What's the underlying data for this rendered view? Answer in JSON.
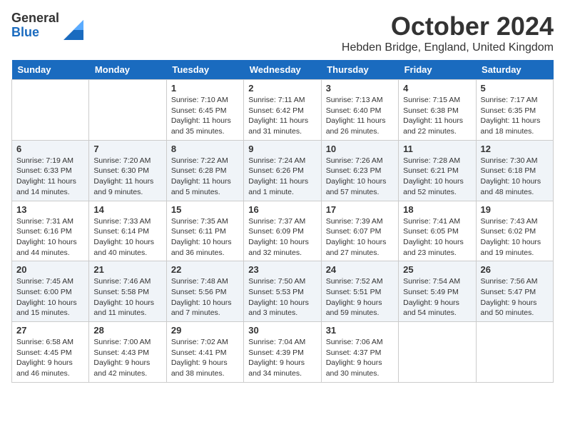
{
  "logo": {
    "general": "General",
    "blue": "Blue"
  },
  "title": "October 2024",
  "location": "Hebden Bridge, England, United Kingdom",
  "days_of_week": [
    "Sunday",
    "Monday",
    "Tuesday",
    "Wednesday",
    "Thursday",
    "Friday",
    "Saturday"
  ],
  "weeks": [
    [
      {
        "day": "",
        "sunrise": "",
        "sunset": "",
        "daylight": ""
      },
      {
        "day": "",
        "sunrise": "",
        "sunset": "",
        "daylight": ""
      },
      {
        "day": "1",
        "sunrise": "Sunrise: 7:10 AM",
        "sunset": "Sunset: 6:45 PM",
        "daylight": "Daylight: 11 hours and 35 minutes."
      },
      {
        "day": "2",
        "sunrise": "Sunrise: 7:11 AM",
        "sunset": "Sunset: 6:42 PM",
        "daylight": "Daylight: 11 hours and 31 minutes."
      },
      {
        "day": "3",
        "sunrise": "Sunrise: 7:13 AM",
        "sunset": "Sunset: 6:40 PM",
        "daylight": "Daylight: 11 hours and 26 minutes."
      },
      {
        "day": "4",
        "sunrise": "Sunrise: 7:15 AM",
        "sunset": "Sunset: 6:38 PM",
        "daylight": "Daylight: 11 hours and 22 minutes."
      },
      {
        "day": "5",
        "sunrise": "Sunrise: 7:17 AM",
        "sunset": "Sunset: 6:35 PM",
        "daylight": "Daylight: 11 hours and 18 minutes."
      }
    ],
    [
      {
        "day": "6",
        "sunrise": "Sunrise: 7:19 AM",
        "sunset": "Sunset: 6:33 PM",
        "daylight": "Daylight: 11 hours and 14 minutes."
      },
      {
        "day": "7",
        "sunrise": "Sunrise: 7:20 AM",
        "sunset": "Sunset: 6:30 PM",
        "daylight": "Daylight: 11 hours and 9 minutes."
      },
      {
        "day": "8",
        "sunrise": "Sunrise: 7:22 AM",
        "sunset": "Sunset: 6:28 PM",
        "daylight": "Daylight: 11 hours and 5 minutes."
      },
      {
        "day": "9",
        "sunrise": "Sunrise: 7:24 AM",
        "sunset": "Sunset: 6:26 PM",
        "daylight": "Daylight: 11 hours and 1 minute."
      },
      {
        "day": "10",
        "sunrise": "Sunrise: 7:26 AM",
        "sunset": "Sunset: 6:23 PM",
        "daylight": "Daylight: 10 hours and 57 minutes."
      },
      {
        "day": "11",
        "sunrise": "Sunrise: 7:28 AM",
        "sunset": "Sunset: 6:21 PM",
        "daylight": "Daylight: 10 hours and 52 minutes."
      },
      {
        "day": "12",
        "sunrise": "Sunrise: 7:30 AM",
        "sunset": "Sunset: 6:18 PM",
        "daylight": "Daylight: 10 hours and 48 minutes."
      }
    ],
    [
      {
        "day": "13",
        "sunrise": "Sunrise: 7:31 AM",
        "sunset": "Sunset: 6:16 PM",
        "daylight": "Daylight: 10 hours and 44 minutes."
      },
      {
        "day": "14",
        "sunrise": "Sunrise: 7:33 AM",
        "sunset": "Sunset: 6:14 PM",
        "daylight": "Daylight: 10 hours and 40 minutes."
      },
      {
        "day": "15",
        "sunrise": "Sunrise: 7:35 AM",
        "sunset": "Sunset: 6:11 PM",
        "daylight": "Daylight: 10 hours and 36 minutes."
      },
      {
        "day": "16",
        "sunrise": "Sunrise: 7:37 AM",
        "sunset": "Sunset: 6:09 PM",
        "daylight": "Daylight: 10 hours and 32 minutes."
      },
      {
        "day": "17",
        "sunrise": "Sunrise: 7:39 AM",
        "sunset": "Sunset: 6:07 PM",
        "daylight": "Daylight: 10 hours and 27 minutes."
      },
      {
        "day": "18",
        "sunrise": "Sunrise: 7:41 AM",
        "sunset": "Sunset: 6:05 PM",
        "daylight": "Daylight: 10 hours and 23 minutes."
      },
      {
        "day": "19",
        "sunrise": "Sunrise: 7:43 AM",
        "sunset": "Sunset: 6:02 PM",
        "daylight": "Daylight: 10 hours and 19 minutes."
      }
    ],
    [
      {
        "day": "20",
        "sunrise": "Sunrise: 7:45 AM",
        "sunset": "Sunset: 6:00 PM",
        "daylight": "Daylight: 10 hours and 15 minutes."
      },
      {
        "day": "21",
        "sunrise": "Sunrise: 7:46 AM",
        "sunset": "Sunset: 5:58 PM",
        "daylight": "Daylight: 10 hours and 11 minutes."
      },
      {
        "day": "22",
        "sunrise": "Sunrise: 7:48 AM",
        "sunset": "Sunset: 5:56 PM",
        "daylight": "Daylight: 10 hours and 7 minutes."
      },
      {
        "day": "23",
        "sunrise": "Sunrise: 7:50 AM",
        "sunset": "Sunset: 5:53 PM",
        "daylight": "Daylight: 10 hours and 3 minutes."
      },
      {
        "day": "24",
        "sunrise": "Sunrise: 7:52 AM",
        "sunset": "Sunset: 5:51 PM",
        "daylight": "Daylight: 9 hours and 59 minutes."
      },
      {
        "day": "25",
        "sunrise": "Sunrise: 7:54 AM",
        "sunset": "Sunset: 5:49 PM",
        "daylight": "Daylight: 9 hours and 54 minutes."
      },
      {
        "day": "26",
        "sunrise": "Sunrise: 7:56 AM",
        "sunset": "Sunset: 5:47 PM",
        "daylight": "Daylight: 9 hours and 50 minutes."
      }
    ],
    [
      {
        "day": "27",
        "sunrise": "Sunrise: 6:58 AM",
        "sunset": "Sunset: 4:45 PM",
        "daylight": "Daylight: 9 hours and 46 minutes."
      },
      {
        "day": "28",
        "sunrise": "Sunrise: 7:00 AM",
        "sunset": "Sunset: 4:43 PM",
        "daylight": "Daylight: 9 hours and 42 minutes."
      },
      {
        "day": "29",
        "sunrise": "Sunrise: 7:02 AM",
        "sunset": "Sunset: 4:41 PM",
        "daylight": "Daylight: 9 hours and 38 minutes."
      },
      {
        "day": "30",
        "sunrise": "Sunrise: 7:04 AM",
        "sunset": "Sunset: 4:39 PM",
        "daylight": "Daylight: 9 hours and 34 minutes."
      },
      {
        "day": "31",
        "sunrise": "Sunrise: 7:06 AM",
        "sunset": "Sunset: 4:37 PM",
        "daylight": "Daylight: 9 hours and 30 minutes."
      },
      {
        "day": "",
        "sunrise": "",
        "sunset": "",
        "daylight": ""
      },
      {
        "day": "",
        "sunrise": "",
        "sunset": "",
        "daylight": ""
      }
    ]
  ]
}
